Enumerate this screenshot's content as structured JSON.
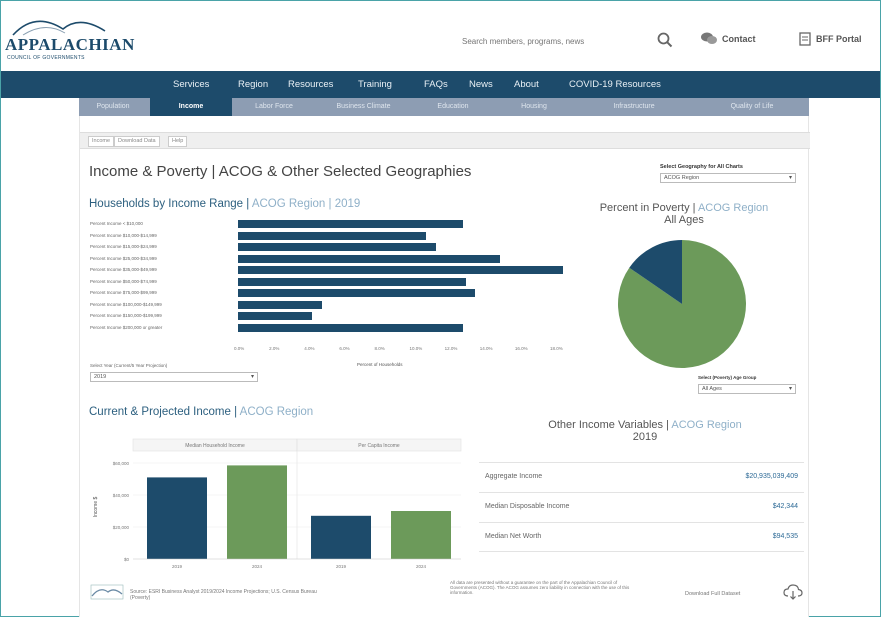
{
  "header": {
    "logo_text": "APPALACHIAN",
    "logo_sub": "COUNCIL OF GOVERNMENTS",
    "search_placeholder": "Search members, programs, news",
    "contact_label": "Contact",
    "portal_label": "BFF Portal"
  },
  "nav": {
    "items": [
      "Services",
      "Region",
      "Resources",
      "Training",
      "FAQs",
      "News",
      "About",
      "COVID-19 Resources"
    ]
  },
  "subnav": {
    "items": [
      "Population",
      "Income",
      "Labor Force",
      "Business Climate",
      "Education",
      "Housing",
      "Infrastructure",
      "Quality of Life"
    ],
    "active_index": 1
  },
  "tabs": [
    "Income",
    "Download Data",
    "Help"
  ],
  "dashboard": {
    "title": "Income & Poverty | ACOG & Other Selected Geographies",
    "geo_select_label": "Select Geography for All Charts",
    "geo_select_value": "ACOG Region",
    "households": {
      "title_main": "Households by Income Range |",
      "title_hl": "ACOG Region | 2019",
      "categories": [
        "Percent Income < $10,000",
        "Percent Income $10,000-$14,999",
        "Percent Income $15,000-$24,999",
        "Percent Income $25,000-$34,999",
        "Percent Income $35,000-$49,999",
        "Percent Income $50,000-$74,999",
        "Percent Income $75,000-$99,999",
        "Percent Income $100,000-$149,999",
        "Percent Income $150,000-$199,999",
        "Percent Income $200,000 or greater"
      ],
      "ticks": [
        "0.0%",
        "2.0%",
        "4.0%",
        "6.0%",
        "8.0%",
        "10.0%",
        "12.0%",
        "14.0%",
        "16.0%",
        "18.0%"
      ],
      "x_title": "Percent of Households",
      "year_label": "Select Year (Current/5 Year Projection)",
      "year_value": "2019"
    },
    "poverty": {
      "title_main": "Percent in Poverty |",
      "title_hl": "ACOG Region",
      "subtitle": "All Ages",
      "age_label": "Select (Poverty) Age Group",
      "age_value": "All Ages",
      "slice_colors": [
        "#6c9a5a",
        "#1d4b6b"
      ]
    },
    "current_projected": {
      "title_main": "Current & Projected Income |",
      "title_hl": "ACOG Region",
      "panels": [
        "Median Household Income",
        "Per Capita Income"
      ],
      "y_ticks": [
        "$60,000",
        "$40,000",
        "$20,000",
        "$0"
      ],
      "y_title": "Income $",
      "x_labels": [
        "2019",
        "2024",
        "2019",
        "2024"
      ]
    },
    "other": {
      "title_main": "Other Income Variables |",
      "title_hl": "ACOG Region",
      "year": "2019",
      "rows": [
        {
          "label": "Aggregate Income",
          "value": "$20,935,039,409"
        },
        {
          "label": "Median Disposable Income",
          "value": "$42,344"
        },
        {
          "label": "Median Net Worth",
          "value": "$94,535"
        }
      ]
    },
    "footer": {
      "source": "Source: ESRI Business Analyst 2019/2024 Income Projections; U.S. Census Bureau (Poverty)",
      "disclaimer": "All data are presented without a guarantee on the part of the Appalachian Council of Governments (ACOG). The ACOG assumes zero liability in connection with the use of this information.",
      "download_label": "Download Full Dataset"
    }
  },
  "chart_data": [
    {
      "type": "bar",
      "orientation": "horizontal",
      "title": "Households by Income Range | ACOG Region | 2019",
      "xlabel": "Percent of Households",
      "categories": [
        "Percent Income < $10,000",
        "Percent Income $10,000-$14,999",
        "Percent Income $15,000-$24,999",
        "Percent Income $25,000-$34,999",
        "Percent Income $35,000-$49,999",
        "Percent Income $50,000-$74,999",
        "Percent Income $75,000-$99,999",
        "Percent Income $100,000-$149,999",
        "Percent Income $150,000-$199,999",
        "Percent Income $200,000 or greater"
      ],
      "values": [
        12.8,
        10.7,
        11.3,
        14.9,
        18.5,
        13.0,
        13.5,
        4.8,
        4.2,
        12.8
      ],
      "xlim": [
        0,
        18
      ],
      "color": "#1d4b6b"
    },
    {
      "type": "pie",
      "title": "Percent in Poverty | ACOG Region",
      "subtitle": "All Ages",
      "values": [
        84.6,
        15.4
      ],
      "colors": [
        "#6c9a5a",
        "#1d4b6b"
      ]
    },
    {
      "type": "bar",
      "title": "Current & Projected Income | ACOG Region",
      "ylabel": "Income $",
      "panels": [
        {
          "name": "Median Household Income",
          "categories": [
            "2019",
            "2024"
          ],
          "values": [
            51000,
            58500
          ]
        },
        {
          "name": "Per Capita Income",
          "categories": [
            "2019",
            "2024"
          ],
          "values": [
            27000,
            30000
          ]
        }
      ],
      "ylim": [
        0,
        65000
      ],
      "colors": [
        "#1d4b6b",
        "#6c9a5a"
      ]
    }
  ]
}
